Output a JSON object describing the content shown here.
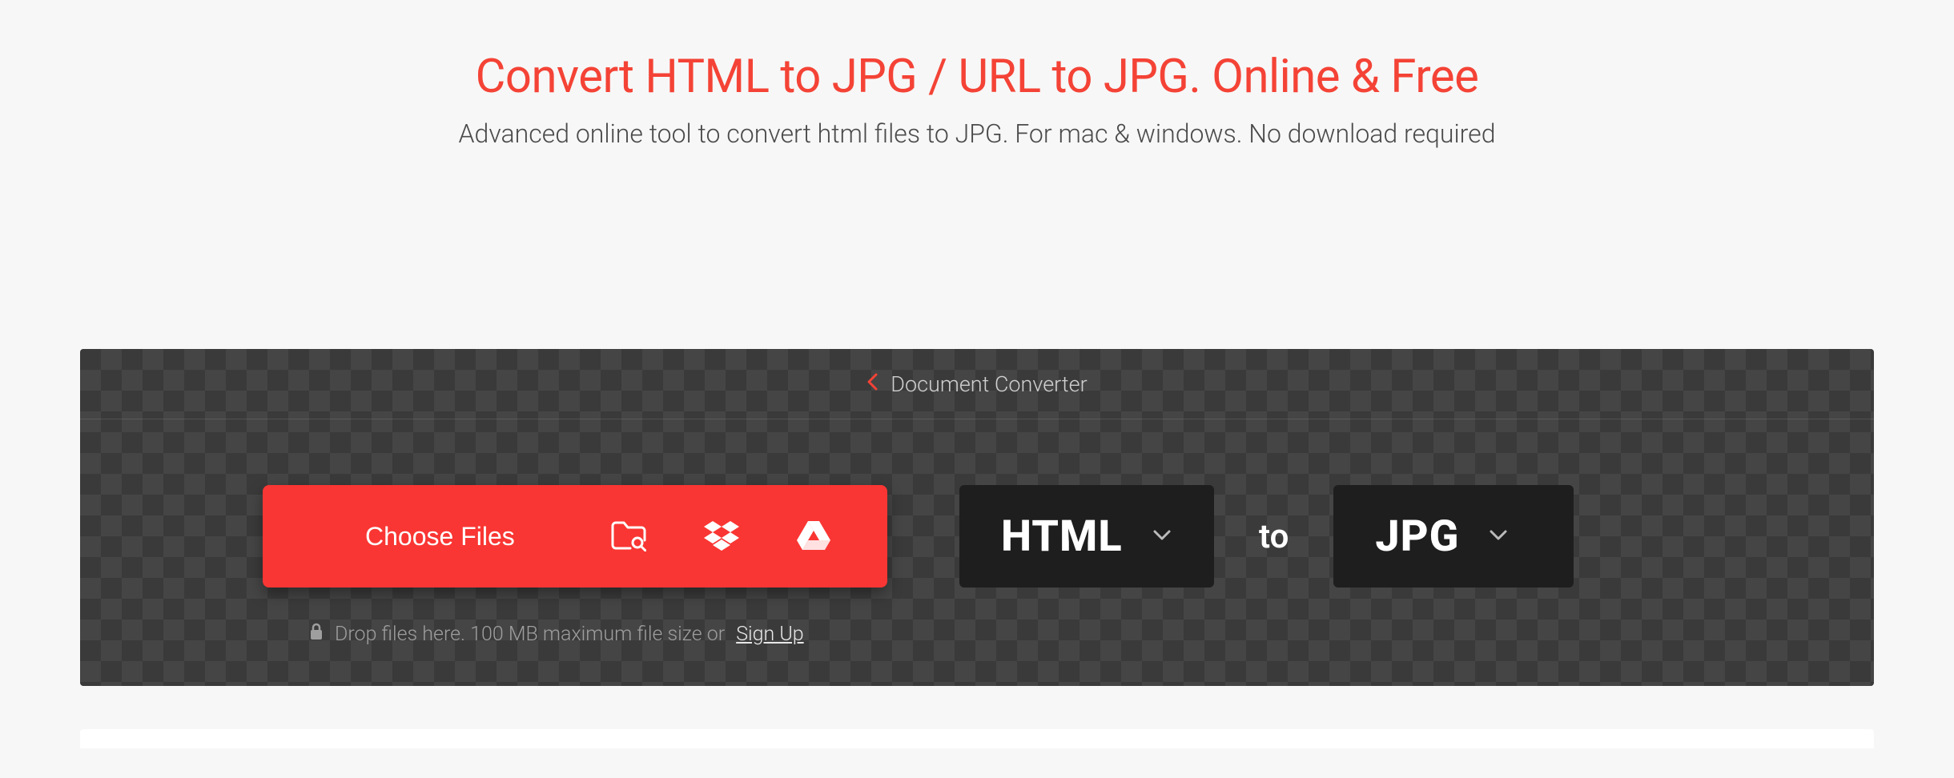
{
  "header": {
    "title": "Convert HTML to JPG / URL to JPG. Online & Free",
    "subtitle": "Advanced online tool to convert html files to JPG. For mac & windows. No download required"
  },
  "breadcrumb": {
    "label": "Document Converter"
  },
  "uploader": {
    "choose_label": "Choose Files",
    "hint_prefix": "Drop files here. 100 MB maximum file size or ",
    "signup_label": "Sign Up"
  },
  "formats": {
    "source": "HTML",
    "to_label": "to",
    "target": "JPG"
  },
  "icons": {
    "folder_search": "folder-search-icon",
    "dropbox": "dropbox-icon",
    "gdrive": "google-drive-icon",
    "lock": "lock-icon",
    "chevron_left": "chevron-left-icon",
    "chevron_down": "chevron-down-icon"
  }
}
